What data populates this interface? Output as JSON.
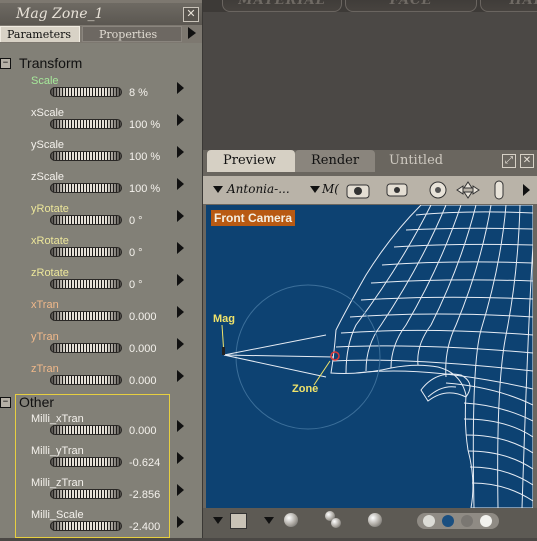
{
  "top_tabs": [
    "MATERIAL",
    "FACE",
    "HAIR"
  ],
  "params_panel": {
    "title": "Mag Zone_1",
    "tabs": [
      "Parameters",
      "Properties"
    ],
    "transform_group": "Transform",
    "other_group": "Other",
    "transform_params": [
      {
        "label": "Scale",
        "value": "8 %",
        "color": "#a6e89a"
      },
      {
        "label": "xScale",
        "value": "100 %",
        "color": "#f4f1ec"
      },
      {
        "label": "yScale",
        "value": "100 %",
        "color": "#f4f1ec"
      },
      {
        "label": "zScale",
        "value": "100 %",
        "color": "#f4f1ec"
      },
      {
        "label": "yRotate",
        "value": "0 °",
        "color": "#ece69a"
      },
      {
        "label": "xRotate",
        "value": "0 °",
        "color": "#ece69a"
      },
      {
        "label": "zRotate",
        "value": "0 °",
        "color": "#ece69a"
      },
      {
        "label": "xTran",
        "value": "0.000",
        "color": "#f0b88a"
      },
      {
        "label": "yTran",
        "value": "0.000",
        "color": "#f0b88a"
      },
      {
        "label": "zTran",
        "value": "0.000",
        "color": "#f0b88a"
      }
    ],
    "other_params": [
      {
        "label": "Milli_xTran",
        "value": "0.000",
        "color": "#f4f1ec"
      },
      {
        "label": "Milli_yTran",
        "value": "-0.624",
        "color": "#f4f1ec"
      },
      {
        "label": "Milli_zTran",
        "value": "-2.856",
        "color": "#f4f1ec"
      },
      {
        "label": "Milli_Scale",
        "value": "-2.400",
        "color": "#f4f1ec"
      }
    ]
  },
  "preview_window": {
    "tabs": [
      "Preview",
      "Render",
      "Untitled"
    ],
    "toolbar": {
      "figure": "Antonia-...",
      "element": "M("
    },
    "viewport": {
      "camera": "Front Camera",
      "mag_label": "Mag",
      "zone_label": "Zone",
      "background": "#0d4272",
      "label_color": "#f0e36a"
    },
    "color_dots": [
      "#dcdcd6",
      "#1a4f80",
      "#7a7772",
      "#f2f2ee"
    ]
  }
}
